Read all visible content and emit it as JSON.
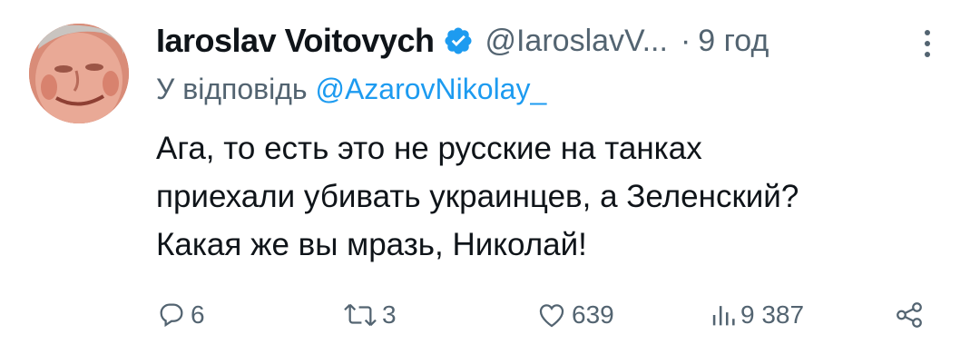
{
  "tweet": {
    "author_name": "Iaroslav Voitovych",
    "handle": "@IaroslavV...",
    "dot": "·",
    "time": "9 год",
    "reply_prefix": "У відповідь ",
    "reply_mention": "@AzarovNikolay_",
    "text_lines": [
      "Ага, то есть это не русские на танках",
      "приехали убивать украинцев, а Зеленский?",
      "Какая же вы мразь, Николай!"
    ],
    "icons": {
      "verified": "verified-badge-icon",
      "more": "more-vertical-icon",
      "reply": "reply-icon",
      "retweet": "retweet-icon",
      "like": "heart-icon",
      "views": "views-icon",
      "share": "share-icon"
    },
    "colors": {
      "accent": "#1d9bf0",
      "secondary_text": "#536471",
      "primary_text": "#0f1419"
    }
  },
  "actions": {
    "replies": "6",
    "retweets": "3",
    "likes": "639",
    "views": "9 387"
  }
}
